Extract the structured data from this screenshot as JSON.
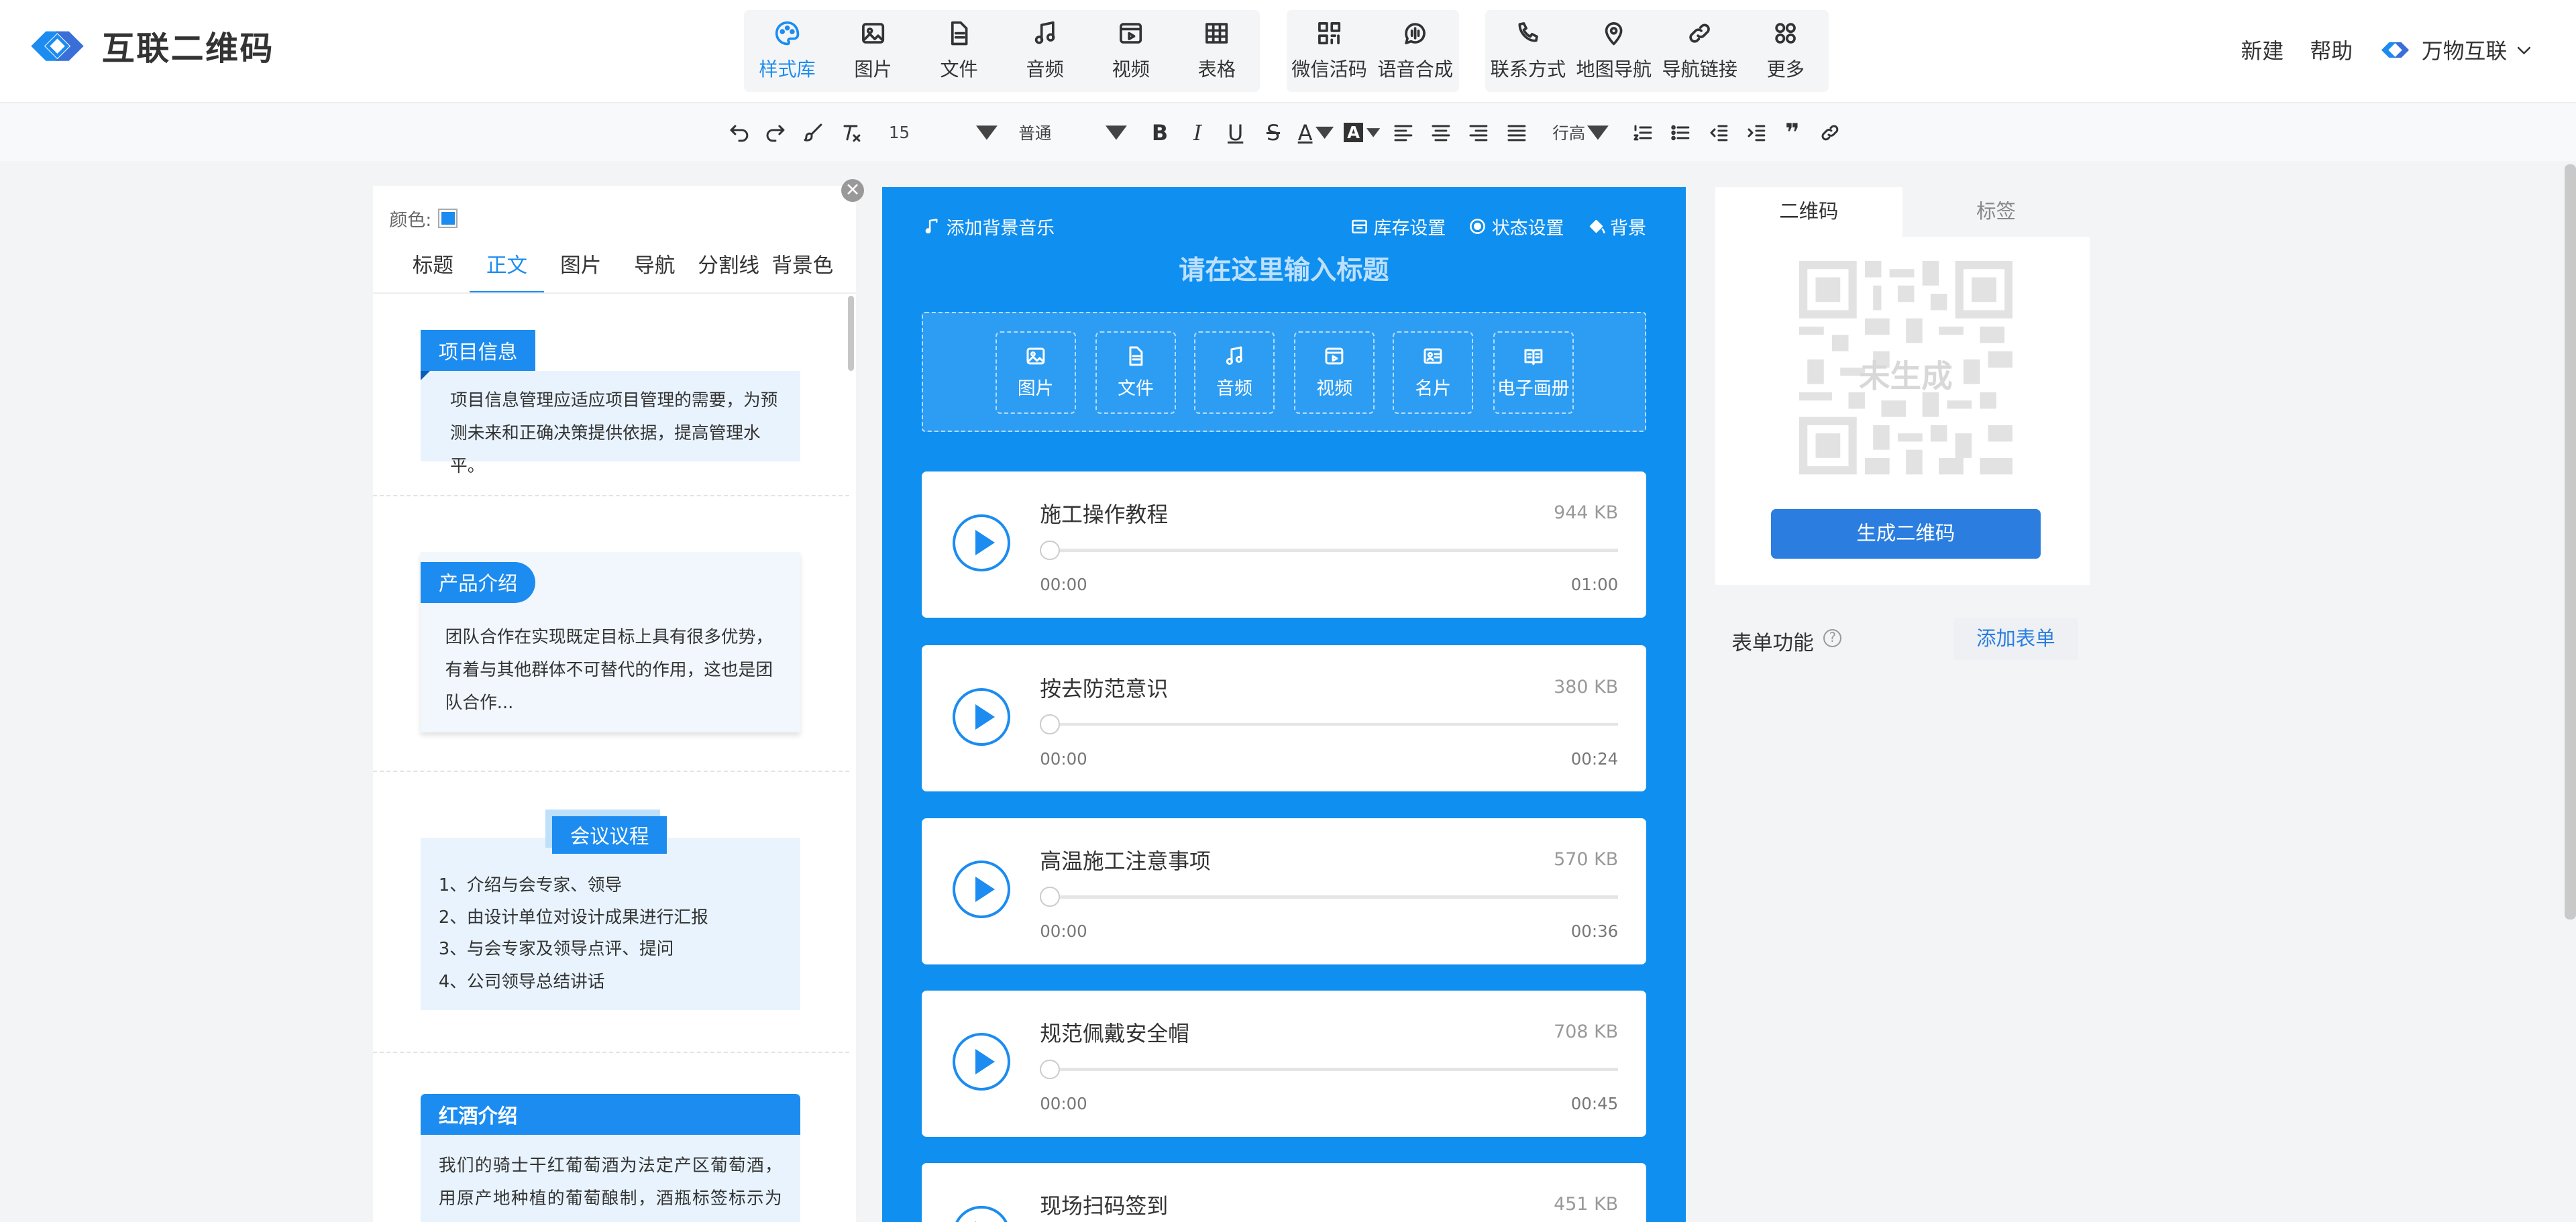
{
  "app": {
    "logo_text": "互联二维码"
  },
  "nav": {
    "group1": [
      {
        "label": "样式库",
        "icon": "palette-icon"
      },
      {
        "label": "图片",
        "icon": "image-icon"
      },
      {
        "label": "文件",
        "icon": "file-icon"
      },
      {
        "label": "音频",
        "icon": "music-icon"
      },
      {
        "label": "视频",
        "icon": "video-icon"
      },
      {
        "label": "表格",
        "icon": "table-icon"
      }
    ],
    "group2": [
      {
        "label": "微信活码",
        "icon": "qrcode-icon"
      },
      {
        "label": "语音合成",
        "icon": "voice-icon"
      }
    ],
    "group3": [
      {
        "label": "联系方式",
        "icon": "phone-icon"
      },
      {
        "label": "地图导航",
        "icon": "map-pin-icon"
      },
      {
        "label": "导航链接",
        "icon": "link-icon"
      },
      {
        "label": "更多",
        "icon": "grid-icon"
      }
    ]
  },
  "header_right": {
    "new": "新建",
    "help": "帮助",
    "brand": "万物互联"
  },
  "toolbar": {
    "font_size": "15",
    "paragraph": "普通",
    "line_height": "行高"
  },
  "left_panel": {
    "color_label": "颜色:",
    "color": "#1c8cf0",
    "tabs": [
      "标题",
      "正文",
      "图片",
      "导航",
      "分割线",
      "背景色"
    ],
    "active_tab": "正文",
    "blocks": {
      "b1": {
        "title": "项目信息",
        "text": "项目信息管理应适应项目管理的需要，为预测未来和正确决策提供依据，提高管理水平。"
      },
      "b2": {
        "title": "产品介绍",
        "text": "团队合作在实现既定目标上具有很多优势，有着与其他群体不可替代的作用，这也是团队合作..."
      },
      "b3": {
        "title": "会议议程",
        "items": [
          "1、介绍与会专家、领导",
          "2、由设计单位对设计成果进行汇报",
          "3、与会专家及领导点评、提问",
          "4、公司领导总结讲话"
        ]
      },
      "b4": {
        "title": "红酒介绍",
        "text": "我们的骑士干红葡萄酒为法定产区葡萄酒，用原产地种植的葡萄酿制，酒瓶标签标示为Appellation：产区"
      }
    }
  },
  "phone": {
    "bg_music": "添加背景音乐",
    "lib_settings": "库存设置",
    "status_settings": "状态设置",
    "background": "背景",
    "title_placeholder": "请在这里输入标题",
    "media_buttons": [
      {
        "label": "图片",
        "icon": "image-icon"
      },
      {
        "label": "文件",
        "icon": "file-icon"
      },
      {
        "label": "音频",
        "icon": "music-icon"
      },
      {
        "label": "视频",
        "icon": "video-icon"
      },
      {
        "label": "名片",
        "icon": "card-icon"
      },
      {
        "label": "电子画册",
        "icon": "book-icon"
      }
    ],
    "audio": [
      {
        "name": "施工操作教程",
        "size": "944 KB",
        "current": "00:00",
        "duration": "01:00"
      },
      {
        "name": "按去防范意识",
        "size": "380 KB",
        "current": "00:00",
        "duration": "00:24"
      },
      {
        "name": "高温施工注意事项",
        "size": "570 KB",
        "current": "00:00",
        "duration": "00:36"
      },
      {
        "name": "规范佩戴安全帽",
        "size": "708 KB",
        "current": "00:00",
        "duration": "00:45"
      },
      {
        "name": "现场扫码签到",
        "size": "451 KB",
        "current": "",
        "duration": ""
      }
    ]
  },
  "qr_panel": {
    "tabs": [
      "二维码",
      "标签"
    ],
    "active_tab": "二维码",
    "placeholder": "未生成",
    "generate": "生成二维码"
  },
  "form": {
    "label": "表单功能",
    "help": "?",
    "add": "添加表单"
  }
}
